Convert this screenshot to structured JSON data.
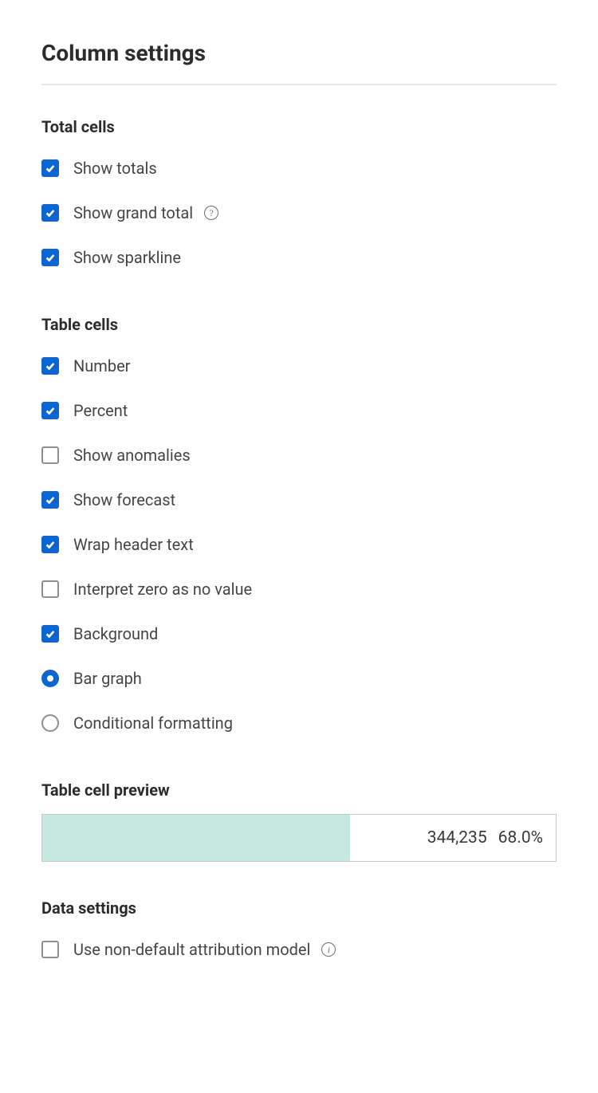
{
  "title": "Column settings",
  "sections": {
    "totalCells": {
      "heading": "Total cells",
      "options": {
        "showTotals": "Show totals",
        "showGrandTotal": "Show grand total",
        "showSparkline": "Show sparkline"
      }
    },
    "tableCells": {
      "heading": "Table cells",
      "options": {
        "number": "Number",
        "percent": "Percent",
        "showAnomalies": "Show anomalies",
        "showForecast": "Show forecast",
        "wrapHeaderText": "Wrap header text",
        "interpretZero": "Interpret zero as no value",
        "background": "Background",
        "barGraph": "Bar graph",
        "conditionalFormatting": "Conditional formatting"
      }
    },
    "preview": {
      "heading": "Table cell preview",
      "value": "344,235",
      "percent": "68.0%",
      "barWidth": "60%"
    },
    "dataSettings": {
      "heading": "Data settings",
      "options": {
        "nonDefaultAttribution": "Use non-default attribution model"
      }
    }
  }
}
